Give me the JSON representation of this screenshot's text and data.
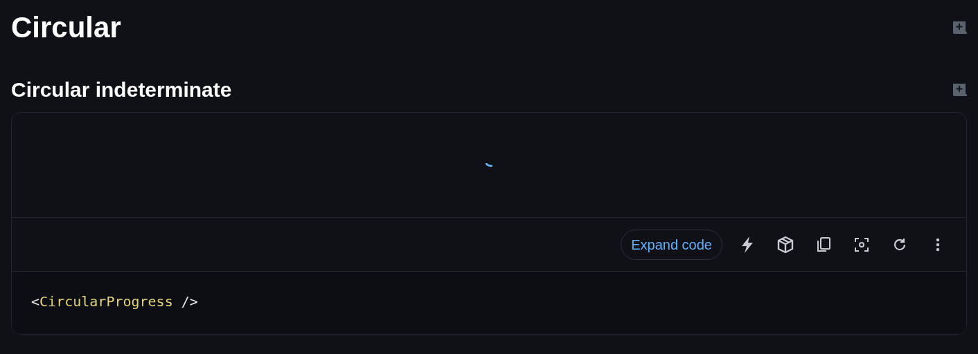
{
  "title": "Circular",
  "section": {
    "title": "Circular indeterminate"
  },
  "toolbar": {
    "expand_button": "Expand code"
  },
  "code": [
    {
      "kind": "punct",
      "text": "<"
    },
    {
      "kind": "component",
      "text": "CircularProgress"
    },
    {
      "kind": "punct",
      "text": " />"
    }
  ]
}
